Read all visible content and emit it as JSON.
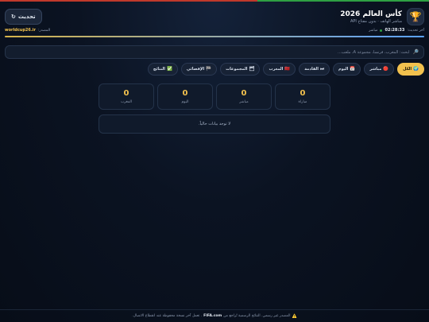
{
  "header": {
    "title": "كأس العالم 2026",
    "subtitle": "مباشر الهاتف · بدون مفتاح API",
    "trophy_icon": "🏆",
    "refresh_label": "تحديث",
    "refresh_icon": "↻"
  },
  "meta": {
    "last_update_label": "آخر تحديث:",
    "last_update_time": "02:28:33",
    "status": "مباشر",
    "source_label": "المصدر:",
    "source_value": "worldcup26.ir"
  },
  "progress": {
    "fraction": 1.0
  },
  "search": {
    "placeholder": "ابحث: المغرب، فرنسا، مجموعة A، ملعب...",
    "icon": "🔎"
  },
  "tabs": [
    {
      "icon": "🌍",
      "label": "الكل",
      "active": true
    },
    {
      "icon": "🔴",
      "label": "مباشر",
      "active": false
    },
    {
      "icon": "📅",
      "label": "اليوم",
      "active": false
    },
    {
      "icon": "⏭",
      "label": "القادمة",
      "active": false
    },
    {
      "icon": "🇲🇦",
      "label": "المغرب",
      "active": false
    },
    {
      "icon": "🗂",
      "label": "المجموعات",
      "active": false
    },
    {
      "icon": "🏁",
      "label": "الإقصائي",
      "active": false
    },
    {
      "icon": "✅",
      "label": "النتائج",
      "active": false
    }
  ],
  "stats": [
    {
      "value": "0",
      "label": "مباراة"
    },
    {
      "value": "0",
      "label": "مباشر"
    },
    {
      "value": "0",
      "label": "اليوم"
    },
    {
      "value": "0",
      "label": "المغرب"
    }
  ],
  "empty_message": "لا توجد بيانات حالياً.",
  "footer": {
    "warn_icon": "⚠️",
    "text_before": "المصدر غير رسمي. النتائج الرسمية تُراجع من",
    "brand": "FIFA.com",
    "text_after": ". تعمل آخر نسخة محفوظة عند انقطاع الاتصال."
  },
  "colors": {
    "accent": "#f2c14e",
    "background": "#0b1322",
    "live": "#2ea043"
  }
}
